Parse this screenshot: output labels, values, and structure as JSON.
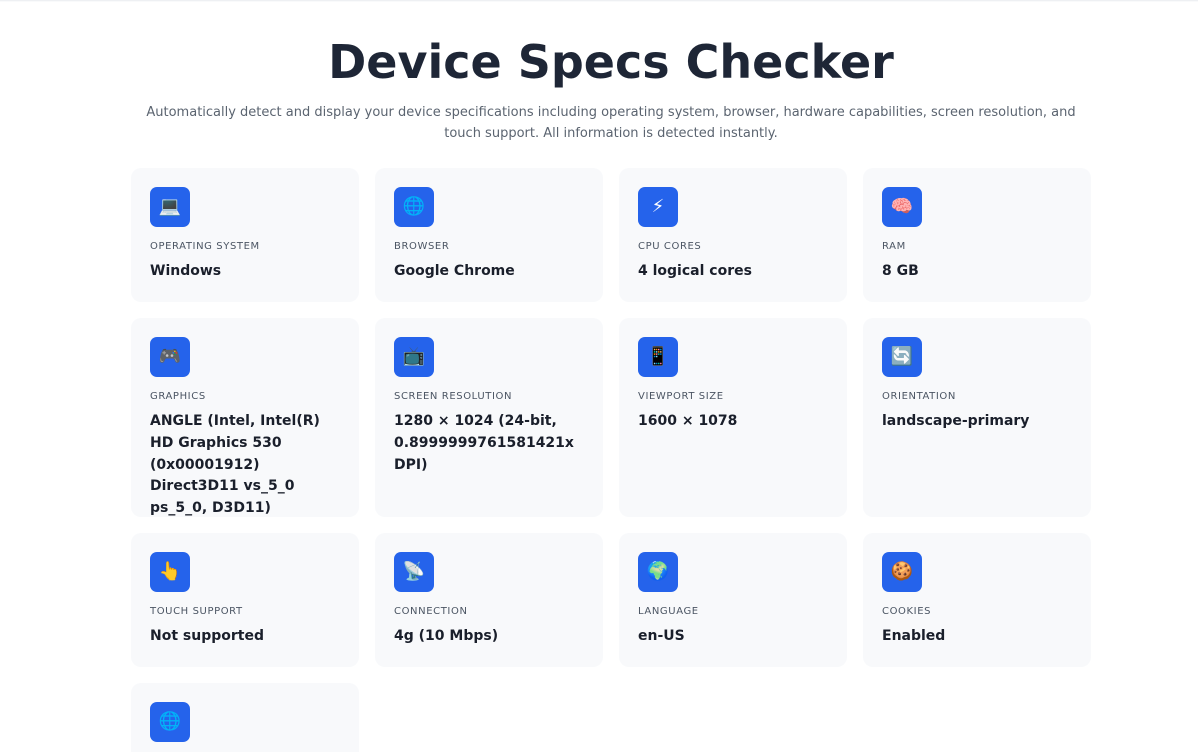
{
  "header": {
    "title": "Device Specs Checker",
    "subtitle": "Automatically detect and display your device specifications including operating system, browser, hardware capabilities, screen resolution, and touch support. All information is detected instantly."
  },
  "colors": {
    "icon_background": "#2563eb",
    "card_background": "#f8f9fb",
    "title": "#1e2636"
  },
  "cards": [
    {
      "icon": "laptop-icon",
      "glyph": "💻",
      "label": "OPERATING SYSTEM",
      "value": "Windows"
    },
    {
      "icon": "globe-icon",
      "glyph": "🌐",
      "label": "BROWSER",
      "value": "Google Chrome"
    },
    {
      "icon": "lightning-icon",
      "glyph": "⚡",
      "label": "CPU CORES",
      "value": "4 logical cores"
    },
    {
      "icon": "brain-icon",
      "glyph": "🧠",
      "label": "RAM",
      "value": "8 GB"
    },
    {
      "icon": "game-controller-icon",
      "glyph": "🎮",
      "label": "GRAPHICS",
      "value": "ANGLE (Intel, Intel(R) HD Graphics 530 (0x00001912) Direct3D11 vs_5_0 ps_5_0, D3D11)"
    },
    {
      "icon": "television-icon",
      "glyph": "📺",
      "label": "SCREEN RESOLUTION",
      "value": "1280 × 1024 (24-bit, 0.8999999761581421x DPI)"
    },
    {
      "icon": "mobile-phone-icon",
      "glyph": "📱",
      "label": "VIEWPORT SIZE",
      "value": "1600 × 1078"
    },
    {
      "icon": "rotate-icon",
      "glyph": "🔄",
      "label": "ORIENTATION",
      "value": "landscape-primary"
    },
    {
      "icon": "pointing-finger-icon",
      "glyph": "👆",
      "label": "TOUCH SUPPORT",
      "value": "Not supported"
    },
    {
      "icon": "satellite-dish-icon",
      "glyph": "📡",
      "label": "CONNECTION",
      "value": "4g (10 Mbps)"
    },
    {
      "icon": "earth-icon",
      "glyph": "🌍",
      "label": "LANGUAGE",
      "value": "en-US"
    },
    {
      "icon": "cookie-icon",
      "glyph": "🍪",
      "label": "COOKIES",
      "value": "Enabled"
    },
    {
      "icon": "globe-icon",
      "glyph": "🌐",
      "label": "",
      "value": ""
    }
  ]
}
